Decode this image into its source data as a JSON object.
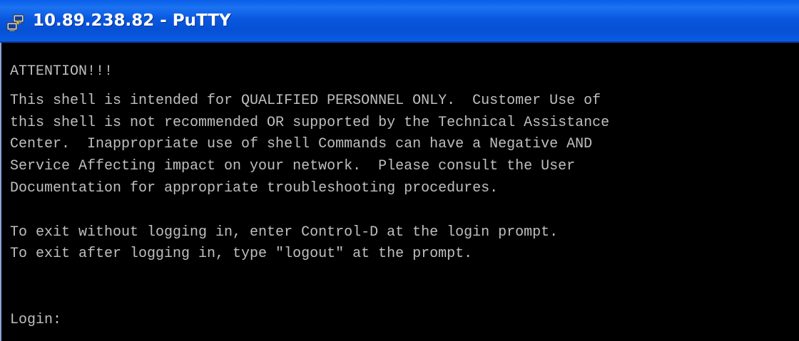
{
  "window": {
    "title": "10.89.238.82 - PuTTY",
    "icon": "putty-icon"
  },
  "terminal": {
    "lines": [
      "ATTENTION!!!",
      "This shell is intended for QUALIFIED PERSONNEL ONLY.  Customer Use of",
      "this shell is not recommended OR supported by the Technical Assistance",
      "Center.  Inappropriate use of shell Commands can have a Negative AND",
      "Service Affecting impact on your network.  Please consult the User",
      "Documentation for appropriate troubleshooting procedures.",
      "",
      "To exit without logging in, enter Control-D at the login prompt.",
      "To exit after logging in, type \"logout\" at the prompt.",
      "",
      "",
      "Login:"
    ]
  },
  "colors": {
    "titlebar": "#0a58e0",
    "terminal_bg": "#000000",
    "terminal_fg": "#bfbfbf"
  }
}
